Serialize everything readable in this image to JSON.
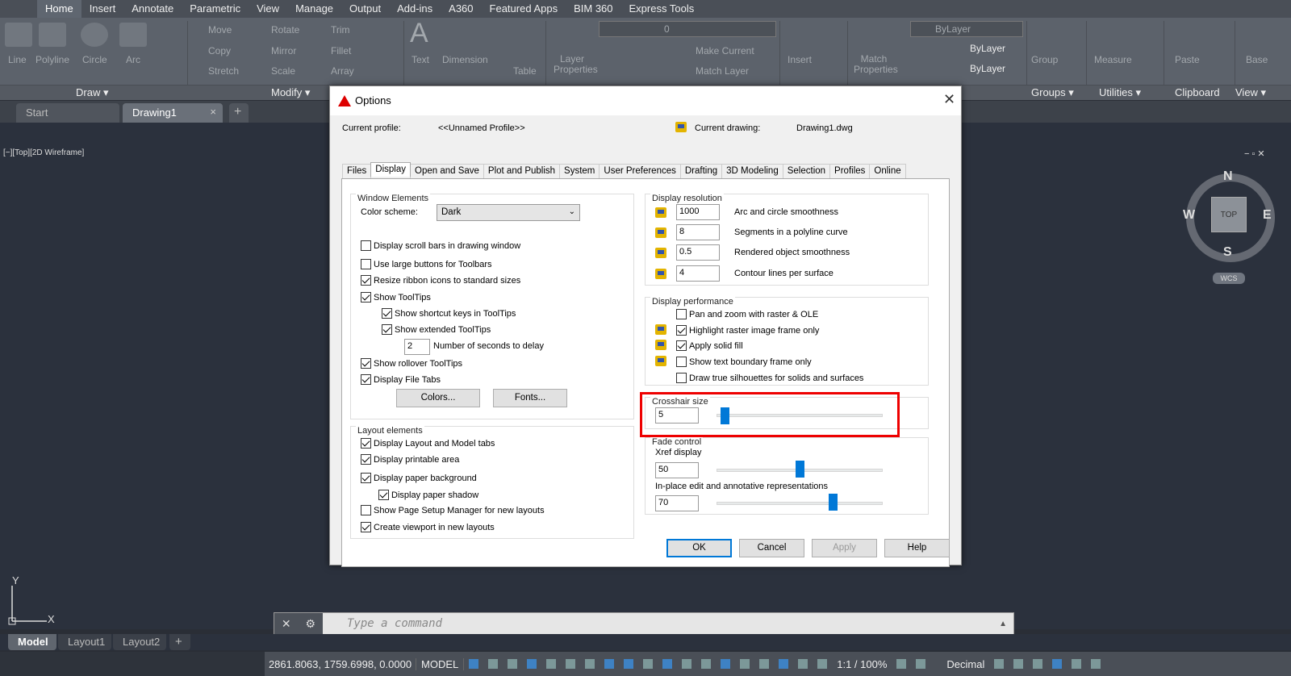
{
  "ribbon": {
    "tabs": [
      "Home",
      "Insert",
      "Annotate",
      "Parametric",
      "View",
      "Manage",
      "Output",
      "Add-ins",
      "A360",
      "Featured Apps",
      "BIM 360",
      "Express Tools"
    ],
    "tools": {
      "line": "Line",
      "polyline": "Polyline",
      "circle": "Circle",
      "arc": "Arc",
      "move": "Move",
      "rotate": "Rotate",
      "trim": "Trim",
      "copy": "Copy",
      "mirror": "Mirror",
      "fillet": "Fillet",
      "stretch": "Stretch",
      "scale": "Scale",
      "array": "Array",
      "text": "Text",
      "dimension": "Dimension",
      "table": "Table",
      "layer_properties": "Layer Properties",
      "layer_value": "0",
      "make_current": "Make Current",
      "match_layer": "Match Layer",
      "insert": "Insert",
      "match_properties": "Match Properties",
      "bylayer1": "ByLayer",
      "bylayer2": "ByLayer",
      "bylayer3": "ByLayer",
      "group": "Group",
      "measure": "Measure",
      "paste": "Paste",
      "base": "Base"
    },
    "panels": {
      "draw": "Draw ▾",
      "modify": "Modify ▾",
      "groups": "Groups ▾",
      "utilities": "Utilities ▾",
      "clipboard": "Clipboard",
      "view": "View ▾"
    }
  },
  "doc_tabs": {
    "start": "Start",
    "drawing1": "Drawing1",
    "close": "×",
    "add": "+"
  },
  "viewport": {
    "label": "[−][Top][2D Wireframe]",
    "compass": {
      "n": "N",
      "s": "S",
      "e": "E",
      "w": "W",
      "top": "TOP",
      "wcs": "WCS"
    },
    "ucs_y": "Y",
    "ucs_x": "X"
  },
  "dialog": {
    "title": "Options",
    "close": "✕",
    "current_profile_label": "Current profile:",
    "current_profile_value": "<<Unnamed Profile>>",
    "current_drawing_label": "Current drawing:",
    "current_drawing_value": "Drawing1.dwg",
    "tabs": [
      "Files",
      "Display",
      "Open and Save",
      "Plot and Publish",
      "System",
      "User Preferences",
      "Drafting",
      "3D Modeling",
      "Selection",
      "Profiles",
      "Online"
    ],
    "window_elements": {
      "title": "Window Elements",
      "color_scheme_label": "Color scheme:",
      "color_scheme_value": "Dark",
      "options": [
        {
          "label": "Display scroll bars in drawing window",
          "checked": false
        },
        {
          "label": "Use large buttons for Toolbars",
          "checked": false
        },
        {
          "label": "Resize ribbon icons to standard sizes",
          "checked": true
        },
        {
          "label": "Show ToolTips",
          "checked": true
        },
        {
          "label": "Show shortcut keys in ToolTips",
          "checked": true
        },
        {
          "label": "Show extended ToolTips",
          "checked": true
        },
        {
          "label": "Show rollover ToolTips",
          "checked": true
        },
        {
          "label": "Display File Tabs",
          "checked": true
        }
      ],
      "delay_value": "2",
      "delay_label": "Number of seconds to delay",
      "colors_button": "Colors...",
      "fonts_button": "Fonts..."
    },
    "layout_elements": {
      "title": "Layout elements",
      "options": [
        {
          "label": "Display Layout and Model tabs",
          "checked": true
        },
        {
          "label": "Display printable area",
          "checked": true
        },
        {
          "label": "Display paper background",
          "checked": true
        },
        {
          "label": "Display paper shadow",
          "checked": true
        },
        {
          "label": "Show Page Setup Manager for new layouts",
          "checked": false
        },
        {
          "label": "Create viewport in new layouts",
          "checked": true
        }
      ]
    },
    "display_resolution": {
      "title": "Display resolution",
      "items": [
        {
          "value": "1000",
          "label": "Arc and circle smoothness"
        },
        {
          "value": "8",
          "label": "Segments in a polyline curve"
        },
        {
          "value": "0.5",
          "label": "Rendered object smoothness"
        },
        {
          "value": "4",
          "label": "Contour lines per surface"
        }
      ]
    },
    "display_performance": {
      "title": "Display performance",
      "options": [
        {
          "label": "Pan and zoom with raster & OLE",
          "checked": false
        },
        {
          "label": "Highlight raster image frame only",
          "checked": true
        },
        {
          "label": "Apply solid fill",
          "checked": true
        },
        {
          "label": "Show text boundary frame only",
          "checked": false
        },
        {
          "label": "Draw true silhouettes for solids and surfaces",
          "checked": false
        }
      ]
    },
    "crosshair": {
      "title": "Crosshair size",
      "value": "5",
      "level": 5
    },
    "fade_control": {
      "title": "Fade control",
      "xref_label": "Xref display",
      "xref_value": "50",
      "xref_level": 50,
      "inplace_label": "In-place edit and annotative representations",
      "inplace_value": "70",
      "inplace_level": 70
    },
    "buttons": {
      "ok": "OK",
      "cancel": "Cancel",
      "apply": "Apply",
      "help": "Help"
    }
  },
  "command_line": {
    "placeholder": "Type a command"
  },
  "layout_tabs": {
    "model": "Model",
    "layout1": "Layout1",
    "layout2": "Layout2",
    "add": "+"
  },
  "status_bar": {
    "coords": "2861.8063, 1759.6998, 0.0000",
    "model": "MODEL",
    "scale": "1:1 / 100%",
    "units": "Decimal"
  }
}
